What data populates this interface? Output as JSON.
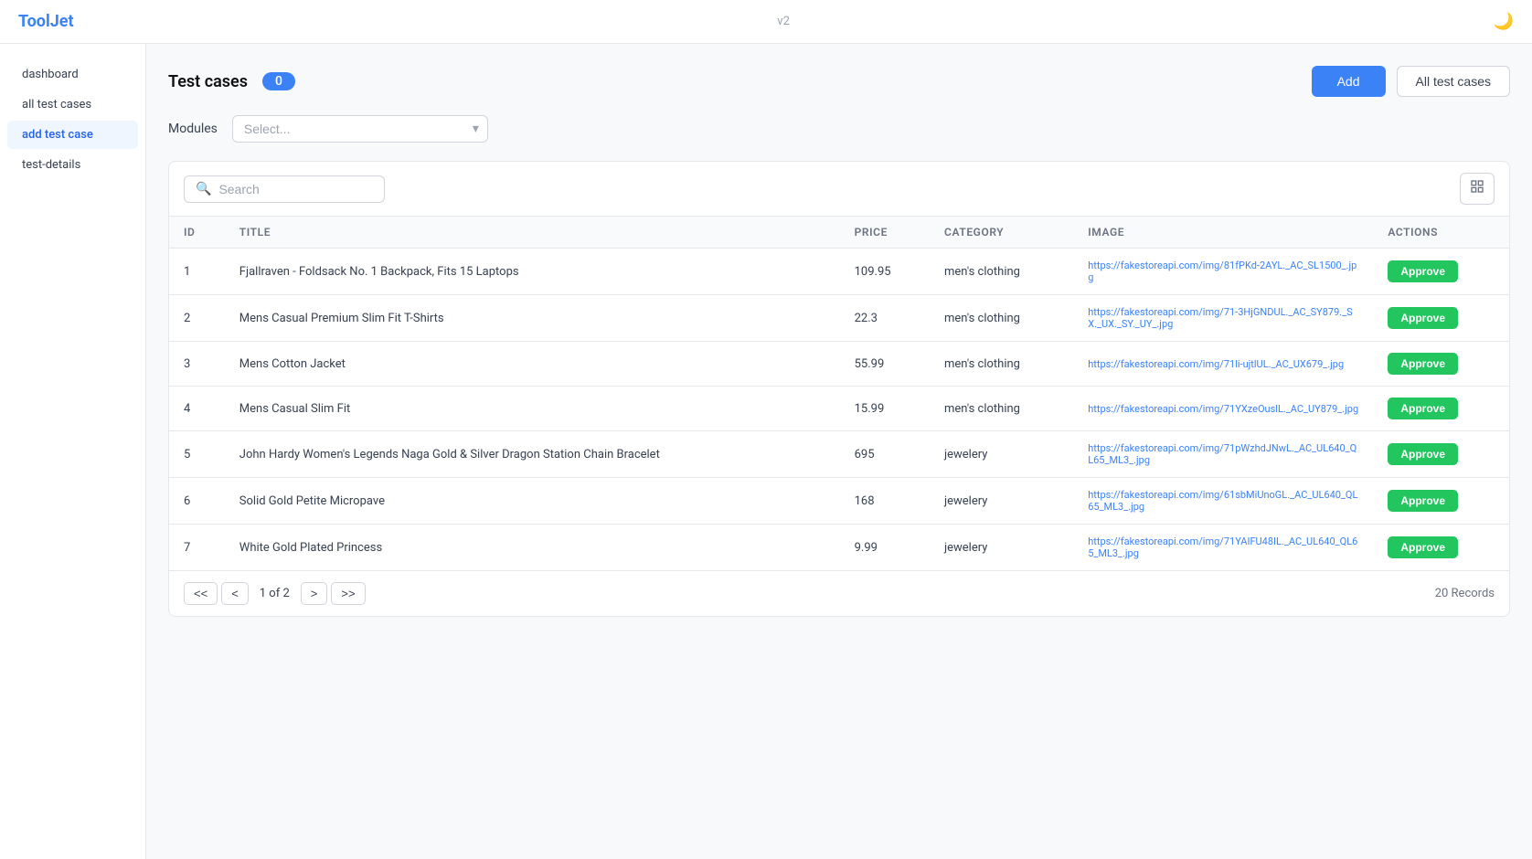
{
  "topbar": {
    "logo": "ToolJet",
    "version": "v2",
    "theme_icon": "🌙"
  },
  "sidebar": {
    "items": [
      {
        "id": "dashboard",
        "label": "dashboard",
        "active": false
      },
      {
        "id": "all-test-cases",
        "label": "all test cases",
        "active": false
      },
      {
        "id": "add-test-case",
        "label": "add test case",
        "active": true
      },
      {
        "id": "test-details",
        "label": "test-details",
        "active": false
      }
    ]
  },
  "header": {
    "title": "Test cases",
    "badge": "0",
    "add_button": "Add",
    "all_button": "All test cases"
  },
  "modules": {
    "label": "Modules",
    "placeholder": "Select..."
  },
  "search": {
    "placeholder": "Search"
  },
  "columns": [
    {
      "key": "id",
      "label": "ID"
    },
    {
      "key": "title",
      "label": "TITLE"
    },
    {
      "key": "price",
      "label": "PRICE"
    },
    {
      "key": "category",
      "label": "CATEGORY"
    },
    {
      "key": "image",
      "label": "IMAGE"
    },
    {
      "key": "actions",
      "label": "ACTIONS"
    }
  ],
  "rows": [
    {
      "id": "1",
      "title": "Fjallraven - Foldsack No. 1 Backpack, Fits 15 Laptops",
      "price": "109.95",
      "category": "men's clothing",
      "image": "https://fakestoreapi.com/img/81fPKd-2AYL._AC_SL1500_.jpg",
      "action": "Approve"
    },
    {
      "id": "2",
      "title": "Mens Casual Premium Slim Fit T-Shirts",
      "price": "22.3",
      "category": "men's clothing",
      "image": "https://fakestoreapi.com/img/71-3HjGNDUL._AC_SY879._SX._UX._SY._UY_.jpg",
      "action": "Approve"
    },
    {
      "id": "3",
      "title": "Mens Cotton Jacket",
      "price": "55.99",
      "category": "men's clothing",
      "image": "https://fakestoreapi.com/img/71li-ujtlUL._AC_UX679_.jpg",
      "action": "Approve"
    },
    {
      "id": "4",
      "title": "Mens Casual Slim Fit",
      "price": "15.99",
      "category": "men's clothing",
      "image": "https://fakestoreapi.com/img/71YXzeOuslL._AC_UY879_.jpg",
      "action": "Approve"
    },
    {
      "id": "5",
      "title": "John Hardy Women's Legends Naga Gold & Silver Dragon Station Chain Bracelet",
      "price": "695",
      "category": "jewelery",
      "image": "https://fakestoreapi.com/img/71pWzhdJNwL._AC_UL640_QL65_ML3_.jpg",
      "action": "Approve"
    },
    {
      "id": "6",
      "title": "Solid Gold Petite Micropave",
      "price": "168",
      "category": "jewelery",
      "image": "https://fakestoreapi.com/img/61sbMiUnoGL._AC_UL640_QL65_ML3_.jpg",
      "action": "Approve"
    },
    {
      "id": "7",
      "title": "White Gold Plated Princess",
      "price": "9.99",
      "category": "jewelery",
      "image": "https://fakestoreapi.com/img/71YAIFU48IL._AC_UL640_QL65_ML3_.jpg",
      "action": "Approve"
    }
  ],
  "pagination": {
    "first": "<<",
    "prev": "<",
    "current": "1 of 2",
    "next": ">",
    "last": ">>",
    "records": "20 Records"
  }
}
